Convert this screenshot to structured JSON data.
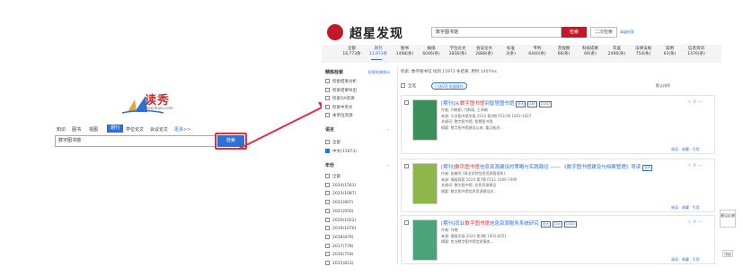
{
  "duxiu": {
    "logo": "读秀",
    "url": "www.duxiu.com",
    "tabs": [
      "知识",
      "图书",
      "视图",
      "期刊",
      "学位论文",
      "会议论文",
      "更多>>"
    ],
    "active_tab": "期刊",
    "search_value": "数字图书馆",
    "search_button": "检索"
  },
  "chaoxing": {
    "title": "超星发现",
    "search_value": "数字图书馆",
    "search_button": "检索",
    "secondary_button": "二次检索",
    "advanced": "高级检索",
    "categories": [
      {
        "label": "全部",
        "count": "16,773条"
      },
      {
        "label": "期刊",
        "count": "11,973条"
      },
      {
        "label": "图书",
        "count": "1498(条)"
      },
      {
        "label": "报纸",
        "count": "6046(条)"
      },
      {
        "label": "学位论文",
        "count": "2836(条)"
      },
      {
        "label": "会议论文",
        "count": "2888(条)"
      },
      {
        "label": "标准",
        "count": "3(条)"
      },
      {
        "label": "专利",
        "count": "6440(条)"
      },
      {
        "label": "音视频",
        "count": "68(条)"
      },
      {
        "label": "科技成果",
        "count": "66(条)"
      },
      {
        "label": "年鉴",
        "count": "2496(条)"
      },
      {
        "label": "法律法规",
        "count": "754(条)"
      },
      {
        "label": "案例",
        "count": "63(条)"
      },
      {
        "label": "信息资讯",
        "count": "1476(条)"
      }
    ],
    "active_category": "期刊",
    "sidebar": {
      "refine_title": "精炼检索",
      "refine_link": "检索结果统计",
      "refine_items": [
        "检索结果分析",
        "检索结果导出",
        "检索OA资源",
        "检索中英文",
        "本单位资源"
      ],
      "lang_title": "语言",
      "lang_items": [
        "全部",
        "中文(11973)"
      ],
      "year_title": "年份",
      "year_items": [
        "全部",
        "2024(1563)",
        "2023(1087)",
        "2022(807)",
        "2021(950)",
        "2020(1022)",
        "2019(1070)",
        "2018(879)",
        "2017(778)",
        "2016(759)",
        "2015(813)"
      ]
    },
    "results_info": "检索: 数字图书馆 找到 11973 条结果, 用时 1407ms",
    "select_all": "全选",
    "export_label": "已选0项 批量操作",
    "sort_label": "默认排序",
    "results": [
      {
        "type": "[期刊]",
        "pre": "从",
        "hl": "数字图书馆",
        "post": "到智慧图书馆",
        "tags": [
          "北大",
          "AMI",
          "CSSCI"
        ],
        "meta": [
          "作者: 刘晓刚, 付群丽, 王泽娟",
          "来源: 大学图书馆学报 2024 第4期 P53-56 1002-1027",
          "关键词: 数字图书馆; 智慧图书馆",
          "摘要: 数字图书馆建设以来, 重点推进..."
        ],
        "actions": "阅读 · 收藏 · 引用"
      },
      {
        "type": "[期刊]",
        "pre": "",
        "hl": "数字图书馆",
        "post": "信息资源建设的策略与实践路径 —— 《数字图书馆建设与档案管理》导读",
        "tags": [
          "北大"
        ],
        "meta": [
          "作者: 张敏秀 (政法学院信息资源管理系)",
          "来源: 情报探索 2024 第7期 P211 1000-7490",
          "关键词: 数字图书馆; 信息资源建设",
          "摘要: 数字图书馆信息资源建设应..."
        ],
        "actions": "阅读 · 收藏 · 引用"
      },
      {
        "type": "[期刊]",
        "pre": "农业",
        "hl": "数字图书馆",
        "post": "信息资源服务系统研究",
        "tags": [
          "北大",
          "CSA",
          "CSSCI"
        ],
        "meta": [
          "作者: 孙晓",
          "来源: 情报学报 2024 第3期 1002-8251",
          "摘要: 农业数字图书馆信息服务..."
        ],
        "actions": "阅读 · 收藏 · 引用"
      }
    ],
    "float_panel": "意见反馈",
    "scroll_top": "顶部"
  }
}
